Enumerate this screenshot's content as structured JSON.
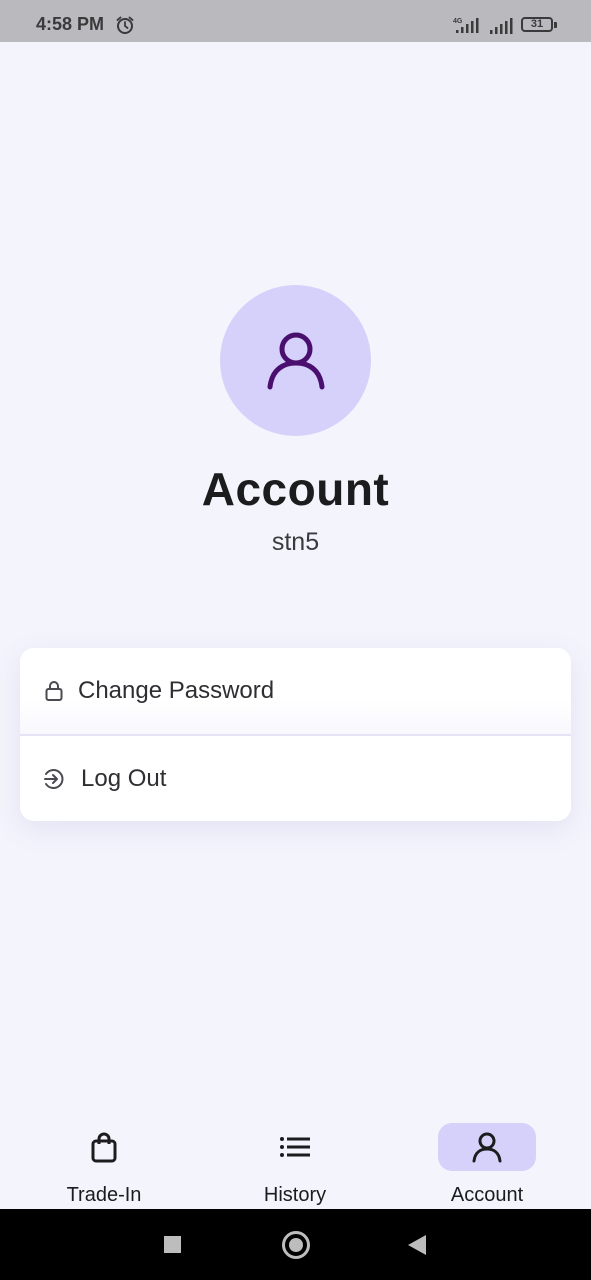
{
  "status_bar": {
    "time": "4:58 PM",
    "network": "4G",
    "battery": "31",
    "icons": [
      "alarm-icon",
      "signal-4g-icon",
      "signal-icon",
      "battery-icon"
    ]
  },
  "profile": {
    "avatar_icon": "user-icon",
    "title": "Account",
    "username": "stn5"
  },
  "menu": {
    "items": [
      {
        "label": "Change Password",
        "icon": "lock-icon"
      },
      {
        "label": "Log Out",
        "icon": "logout-icon"
      }
    ]
  },
  "bottom_nav": {
    "items": [
      {
        "label": "Trade-In",
        "icon": "shopping-bag-icon",
        "active": false
      },
      {
        "label": "History",
        "icon": "list-icon",
        "active": false
      },
      {
        "label": "Account",
        "icon": "user-icon",
        "active": true
      }
    ]
  },
  "colors": {
    "background": "#f4f4fc",
    "avatar_bg": "#d5d1fb",
    "avatar_icon": "#4a0f6e",
    "active_pill": "#d5d1fb",
    "text": "#1c1c1e"
  }
}
